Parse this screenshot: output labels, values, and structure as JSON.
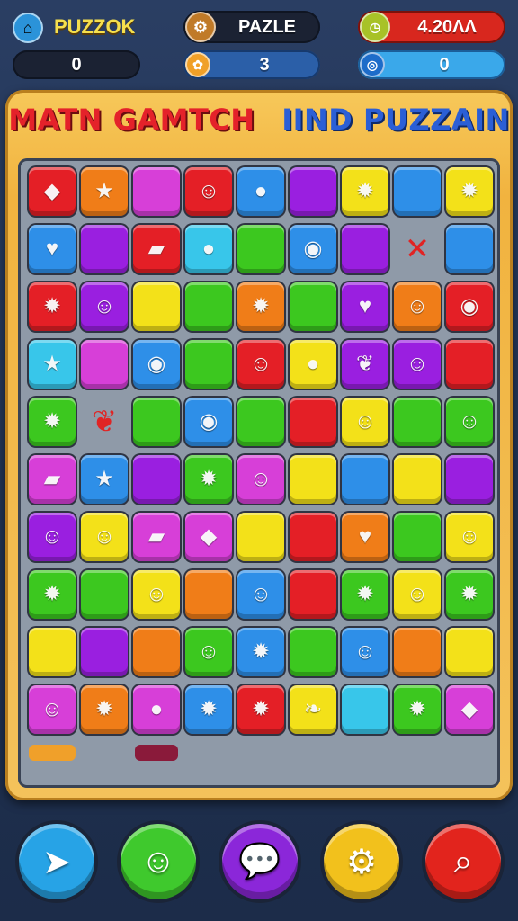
{
  "hud": {
    "slot1_title": "PUZZOK",
    "slot1_value": "0",
    "slot2_title": "PAZLE",
    "slot2_value": "3",
    "slot3_title": "4.20ΛΛ",
    "slot3_value": "0",
    "icon_names": [
      "house-icon",
      "gear-icon",
      "coin-icon",
      "clock-icon",
      "globe-icon"
    ]
  },
  "title": {
    "part1": "MATN GAMTCH",
    "part2": "IIND PUZZAIN"
  },
  "board": {
    "palette": {
      "R": "#e41f26",
      "O": "#f07d18",
      "Y": "#f3e119",
      "G": "#3cc81f",
      "B": "#2e8fe8",
      "C": "#38c6ea",
      "P": "#9a1fe0",
      "M": "#d73fd8",
      "W": "#e9e6d8"
    },
    "rows": [
      [
        "R",
        "O",
        "M",
        "R",
        "B",
        "P",
        "Y",
        "B",
        "Y"
      ],
      [
        "B",
        "P",
        "R",
        "C",
        "G",
        "B",
        "P",
        "N",
        "B"
      ],
      [
        "R",
        "P",
        "Y",
        "G",
        "O",
        "G",
        "P",
        "O",
        "R"
      ],
      [
        "C",
        "M",
        "B",
        "G",
        "R",
        "Y",
        "P",
        "P",
        "R"
      ],
      [
        "G",
        "N",
        "G",
        "B",
        "G",
        "R",
        "Y",
        "G",
        "G"
      ],
      [
        "M",
        "B",
        "P",
        "G",
        "M",
        "Y",
        "B",
        "Y",
        "P"
      ],
      [
        "P",
        "Y",
        "M",
        "M",
        "Y",
        "R",
        "O",
        "G",
        "Y"
      ],
      [
        "G",
        "G",
        "Y",
        "O",
        "B",
        "R",
        "G",
        "Y",
        "G"
      ],
      [
        "Y",
        "P",
        "O",
        "G",
        "B",
        "G",
        "B",
        "O",
        "Y"
      ],
      [
        "M",
        "O",
        "M",
        "B",
        "R",
        "Y",
        "C",
        "G",
        "M"
      ]
    ],
    "icons": [
      [
        "gem-icon",
        "star-icon",
        "",
        "face-icon",
        "orb-icon",
        "",
        "chick-icon",
        "",
        "chick-icon"
      ],
      [
        "heart-icon",
        "",
        "candy-icon",
        "orb-icon",
        "",
        "ring-icon",
        "",
        "bow-icon",
        ""
      ],
      [
        "chick-icon",
        "face-icon",
        "",
        "",
        "chick-icon",
        "",
        "heart-icon",
        "face-icon",
        "ring-icon"
      ],
      [
        "star-icon",
        "",
        "ring-icon",
        "",
        "face-icon",
        "orb-icon",
        "leaf-icon",
        "face-icon",
        ""
      ],
      [
        "chick-icon",
        "leaf-icon",
        "",
        "ring-icon",
        "",
        "",
        "face-icon",
        "",
        "face-icon"
      ],
      [
        "candy-icon",
        "star-icon",
        "",
        "chick-icon",
        "face-icon",
        "",
        "",
        "",
        ""
      ],
      [
        "face-icon",
        "face-icon",
        "candy-icon",
        "gem-icon",
        "",
        "",
        "heart-icon",
        "",
        "face-icon"
      ],
      [
        "chick-icon",
        "",
        "face-icon",
        "",
        "face-icon",
        "",
        "chick-icon",
        "face-icon",
        "chick-icon"
      ],
      [
        "",
        "",
        "",
        "face-icon",
        "chick-icon",
        "",
        "face-icon",
        "",
        ""
      ],
      [
        "face-icon",
        "chick-icon",
        "orb-icon",
        "chick-icon",
        "chick-icon",
        "pepper-icon",
        "",
        "chick-icon",
        "gem-icon"
      ]
    ]
  },
  "bottom_buttons": [
    {
      "name": "arrow-button",
      "icon": "arrow-icon",
      "color": "#27a3e6"
    },
    {
      "name": "character-button",
      "icon": "face-icon",
      "color": "#3fc92d"
    },
    {
      "name": "chat-button",
      "icon": "speech-bubble-icon",
      "color": "#8b27d9"
    },
    {
      "name": "settings-button",
      "icon": "gear-icon",
      "color": "#f2c11c"
    },
    {
      "name": "search-button",
      "icon": "search-icon",
      "color": "#e2241d"
    }
  ]
}
